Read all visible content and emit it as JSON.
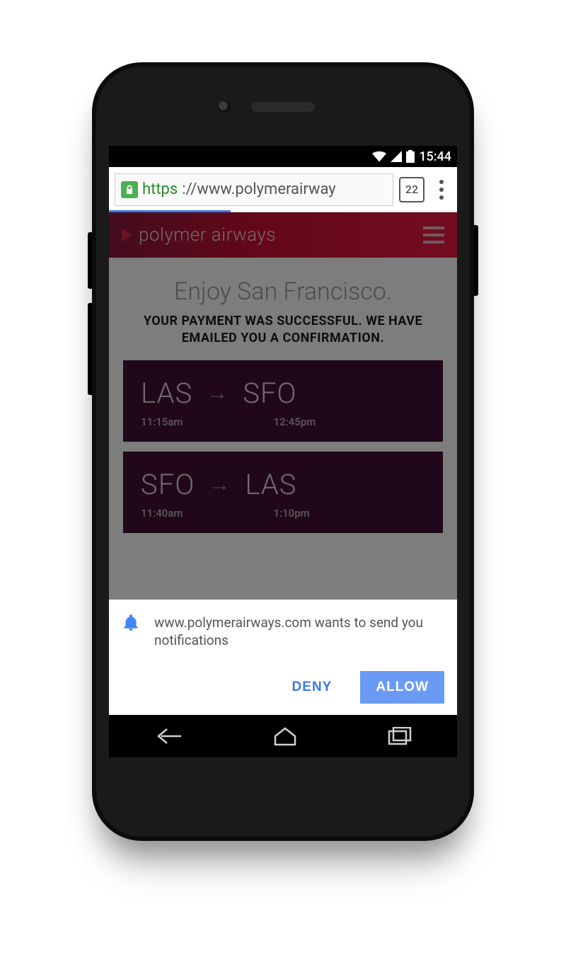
{
  "status": {
    "time": "15:44"
  },
  "browser": {
    "tab_count": "22",
    "url_scheme": "https",
    "url_display": "://www.polymerairway"
  },
  "app": {
    "brand": "polymer airways",
    "hero": "Enjoy San Francisco.",
    "confirmation": "YOUR PAYMENT WAS SUCCESSFUL. WE HAVE EMAILED YOU A CONFIRMATION.",
    "flights": [
      {
        "from": "LAS",
        "to": "SFO",
        "dep": "11:15am",
        "arr": "12:45pm"
      },
      {
        "from": "SFO",
        "to": "LAS",
        "dep": "11:40am",
        "arr": "1:10pm"
      }
    ]
  },
  "prompt": {
    "text": "www.polymerairways.com wants to send you notifications",
    "deny": "DENY",
    "allow": "ALLOW"
  }
}
